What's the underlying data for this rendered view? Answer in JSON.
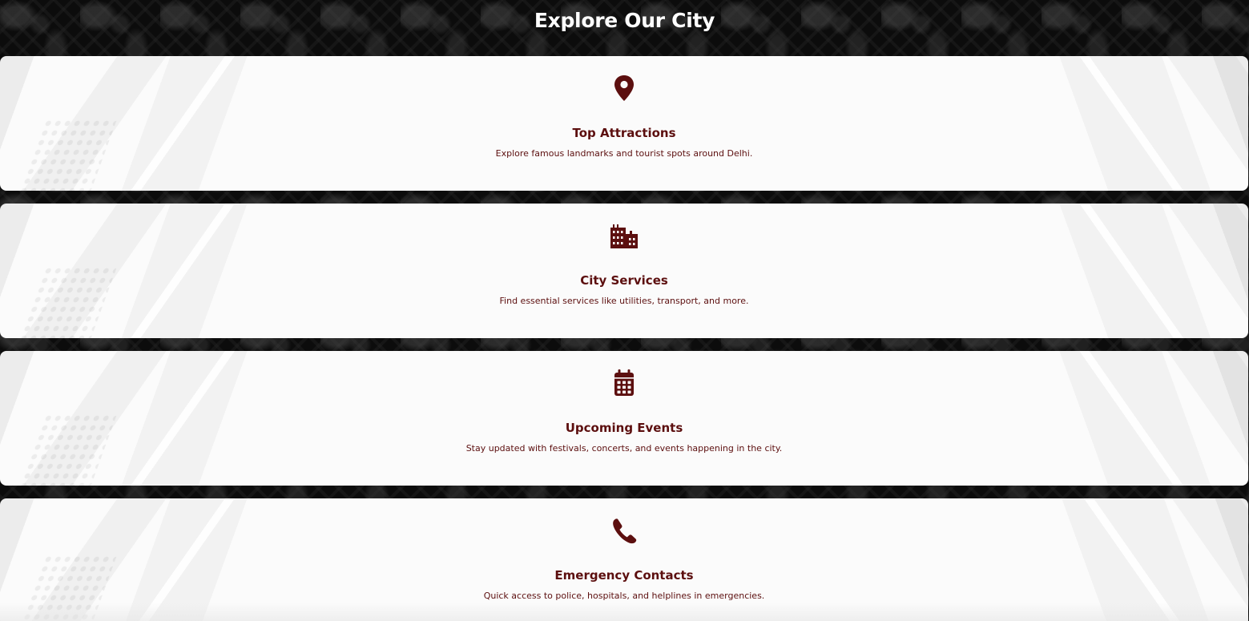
{
  "page": {
    "title": "Explore Our City",
    "background_color": "#0c0c0c",
    "accent_color": "#5c0f0f"
  },
  "cards": [
    {
      "icon": "map-pin-icon",
      "title": "Top Attractions",
      "description": "Explore famous landmarks and tourist spots around Delhi."
    },
    {
      "icon": "city-building-icon",
      "title": "City Services",
      "description": "Find essential services like utilities, transport, and more."
    },
    {
      "icon": "calendar-icon",
      "title": "Upcoming Events",
      "description": "Stay updated with festivals, concerts, and events happening in the city."
    },
    {
      "icon": "phone-icon",
      "title": "Emergency Contacts",
      "description": "Quick access to police, hospitals, and helplines in emergencies."
    }
  ]
}
